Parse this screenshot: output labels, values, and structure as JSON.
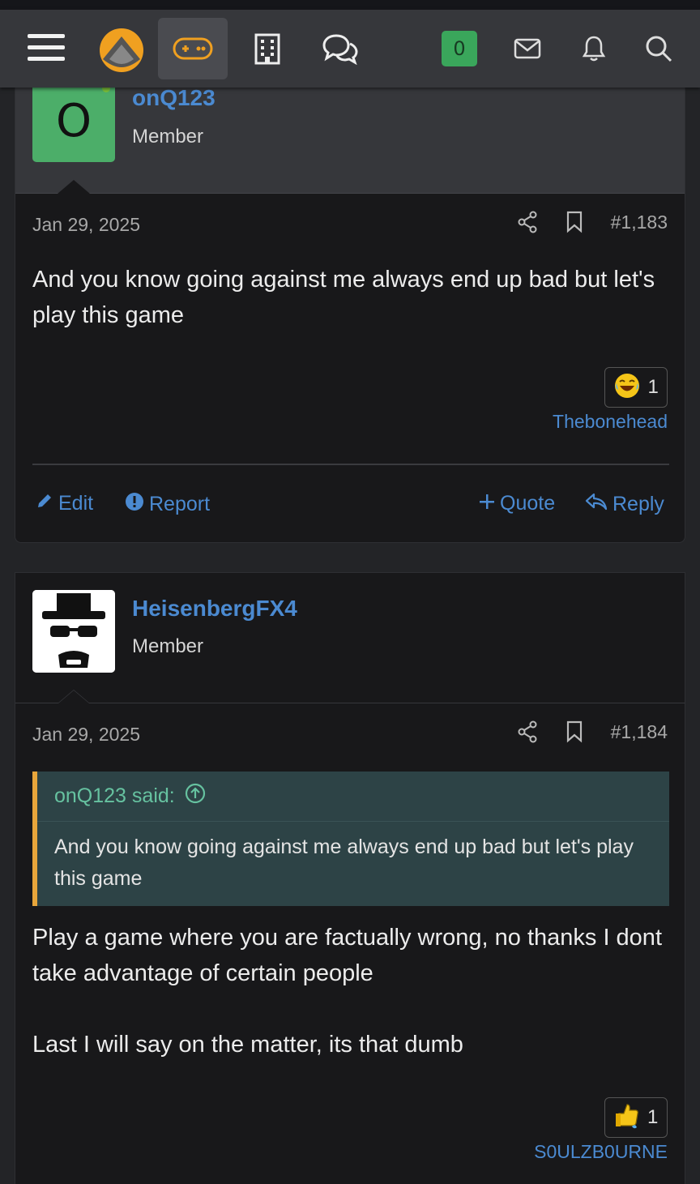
{
  "nav": {
    "menu_icon": "hamburger-menu-icon",
    "logo_icon": "site-logo",
    "games_icon": "gamepad-icon",
    "building_icon": "building-icon",
    "chat_icon": "conversations-icon",
    "user_badge": "0",
    "mail_icon": "envelope-icon",
    "bell_icon": "bell-icon",
    "search_icon": "search-icon"
  },
  "posts": [
    {
      "avatar_letter": "O",
      "username": "onQ123",
      "user_title": "Member",
      "date": "Jan 29, 2025",
      "post_number": "#1,183",
      "body": [
        "And you know going against me always end up bad but let's play this game"
      ],
      "reaction": {
        "emoji": "laughing-face",
        "count": "1",
        "user": "Thebonehead"
      },
      "actions": {
        "edit": "Edit",
        "report": "Report",
        "quote": "Quote",
        "reply": "Reply"
      }
    },
    {
      "username": "HeisenbergFX4",
      "user_title": "Member",
      "date": "Jan 29, 2025",
      "post_number": "#1,184",
      "quote": {
        "author": "onQ123 said:",
        "text": "And you know going against me always end up bad but let's play this game"
      },
      "body": [
        "Play a game where you are factually wrong, no thanks I dont take advantage of certain people",
        "Last I will say on the matter, its that dumb"
      ],
      "reaction": {
        "emoji": "thumbs-up",
        "count": "1",
        "user": "S0ULZB0URNE"
      }
    }
  ],
  "colors": {
    "link": "#4b8ad1",
    "badge_green": "#3aa65b",
    "quote_accent": "#e8a63b",
    "quote_bg": "#2d4346",
    "quote_author": "#66c2a0"
  }
}
